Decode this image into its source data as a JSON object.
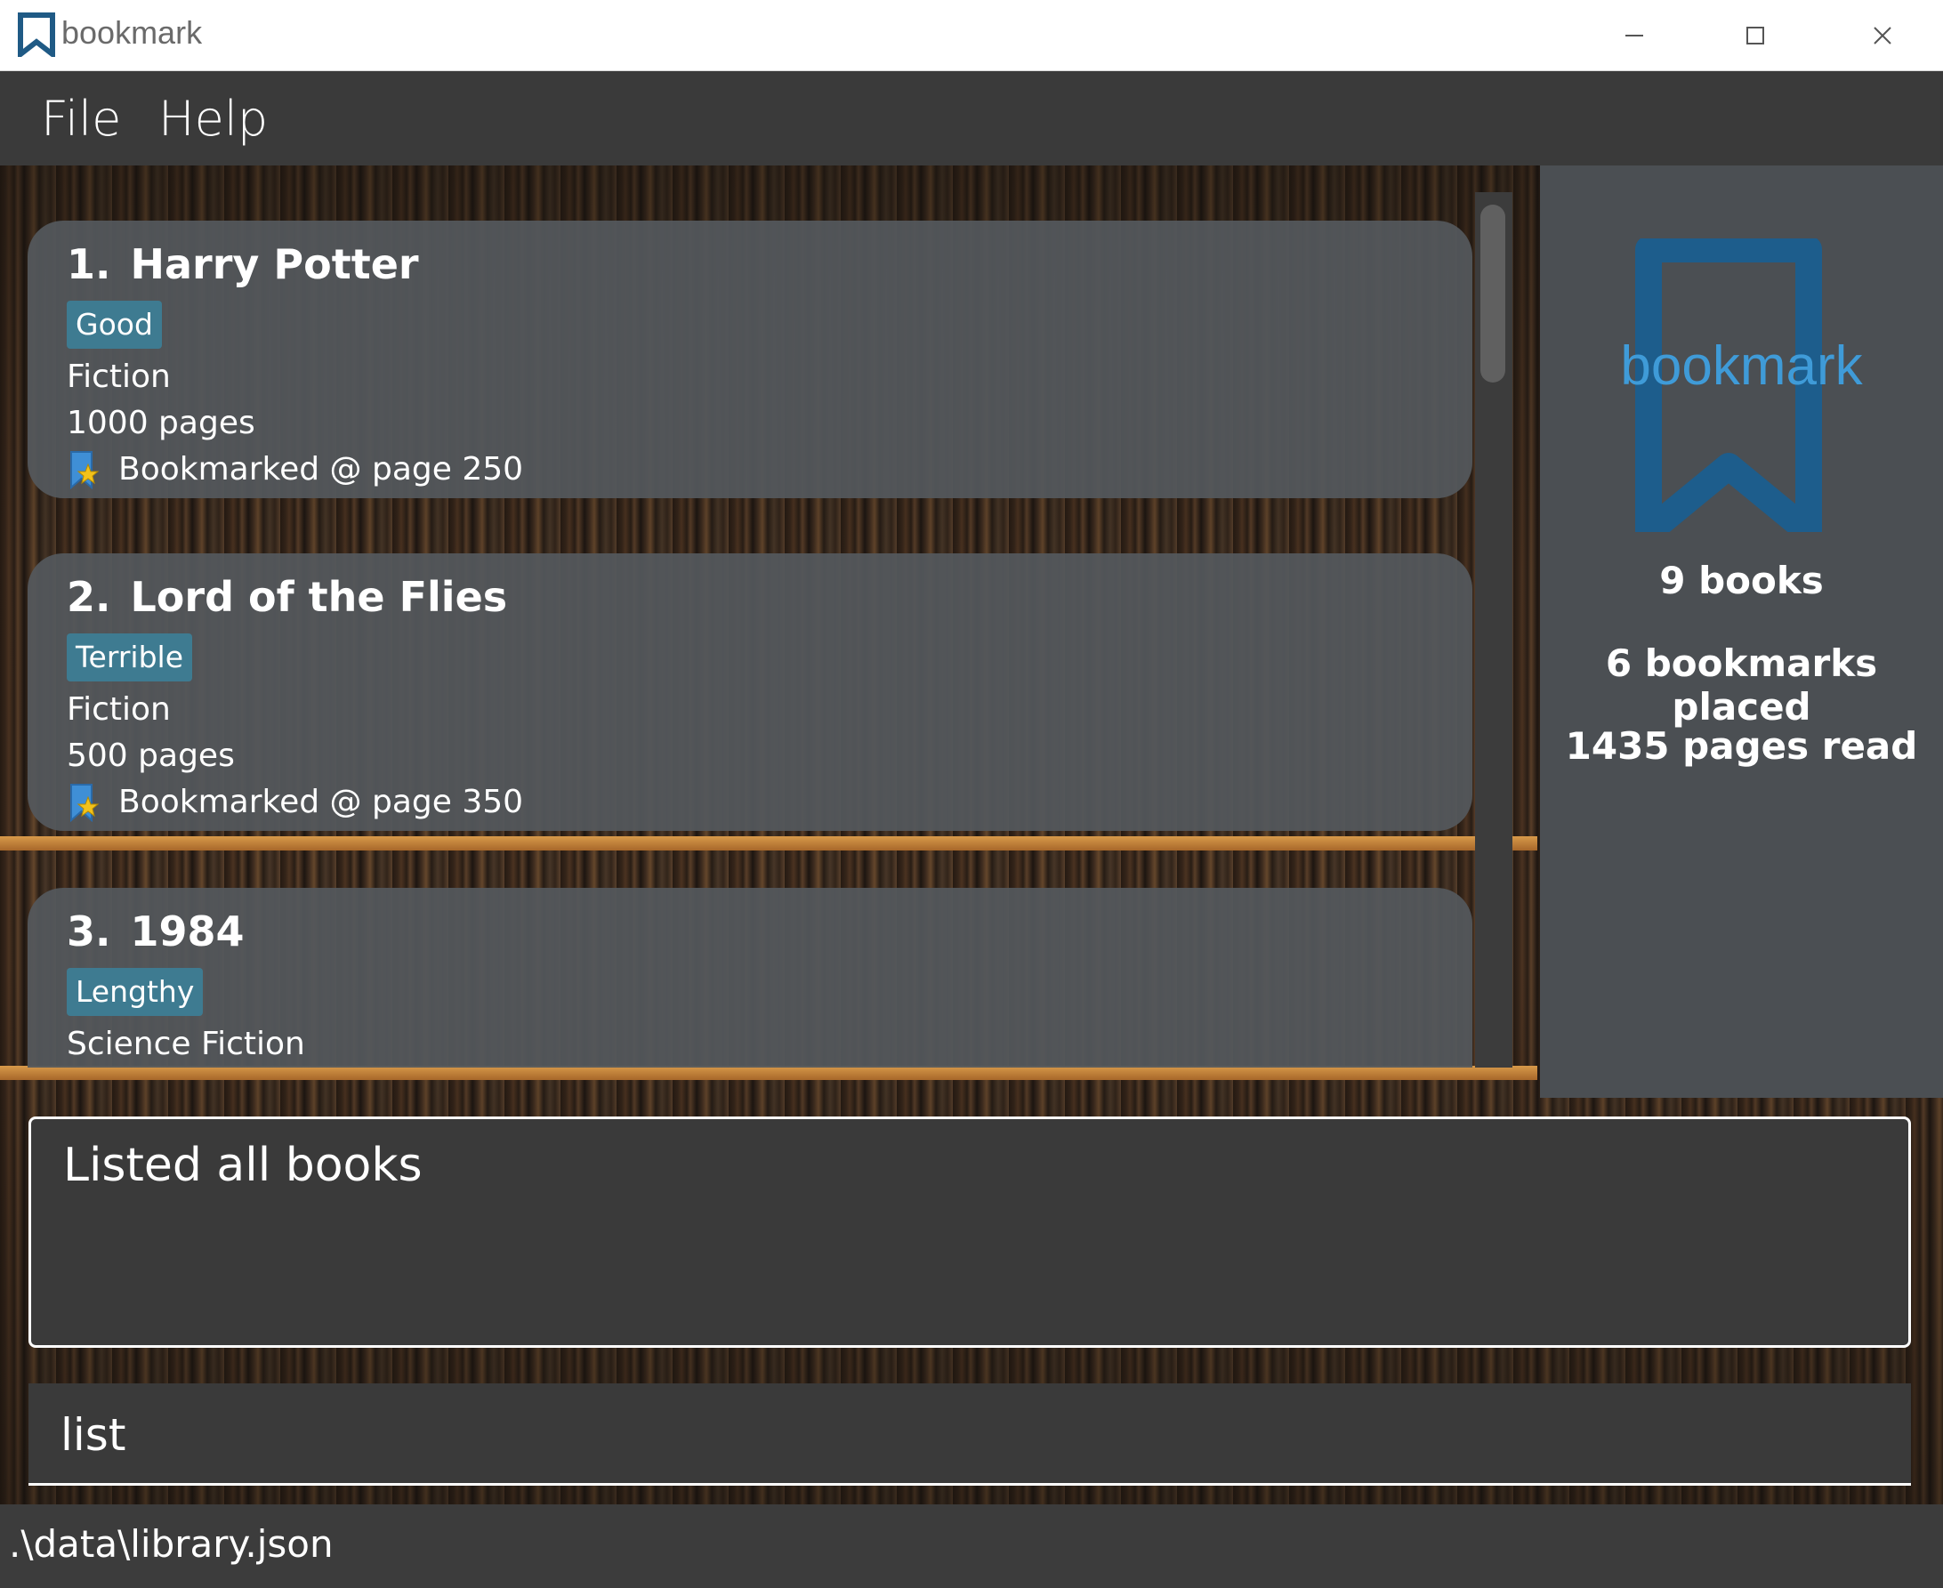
{
  "window": {
    "title": "bookmark",
    "icon": "bookmark-icon"
  },
  "menu": {
    "items": [
      {
        "label": "File"
      },
      {
        "label": "Help"
      }
    ]
  },
  "books": [
    {
      "index": "1.",
      "title": "Harry Potter",
      "tag": "Good",
      "genre": "Fiction",
      "pages": "1000 pages",
      "bookmark": "Bookmarked @ page 250"
    },
    {
      "index": "2.",
      "title": "Lord of the Flies",
      "tag": "Terrible",
      "genre": "Fiction",
      "pages": "500 pages",
      "bookmark": "Bookmarked @ page 350"
    },
    {
      "index": "3.",
      "title": "1984",
      "tag": "Lengthy",
      "genre": "Science Fiction"
    }
  ],
  "stats": {
    "logo_text": "bookmark",
    "books": "9 books",
    "bookmarks": "6 bookmarks placed",
    "pages_read": "1435 pages read"
  },
  "result": {
    "text": "Listed all books"
  },
  "command": {
    "value": "list"
  },
  "status": {
    "path": ".\\data\\library.json"
  },
  "colors": {
    "accent_blue": "#3f9bd8",
    "tag_bg": "#3e7b91",
    "card_bg": "#54585c",
    "panel_bg": "#4b4f53",
    "app_bg": "#3a3a3a"
  }
}
